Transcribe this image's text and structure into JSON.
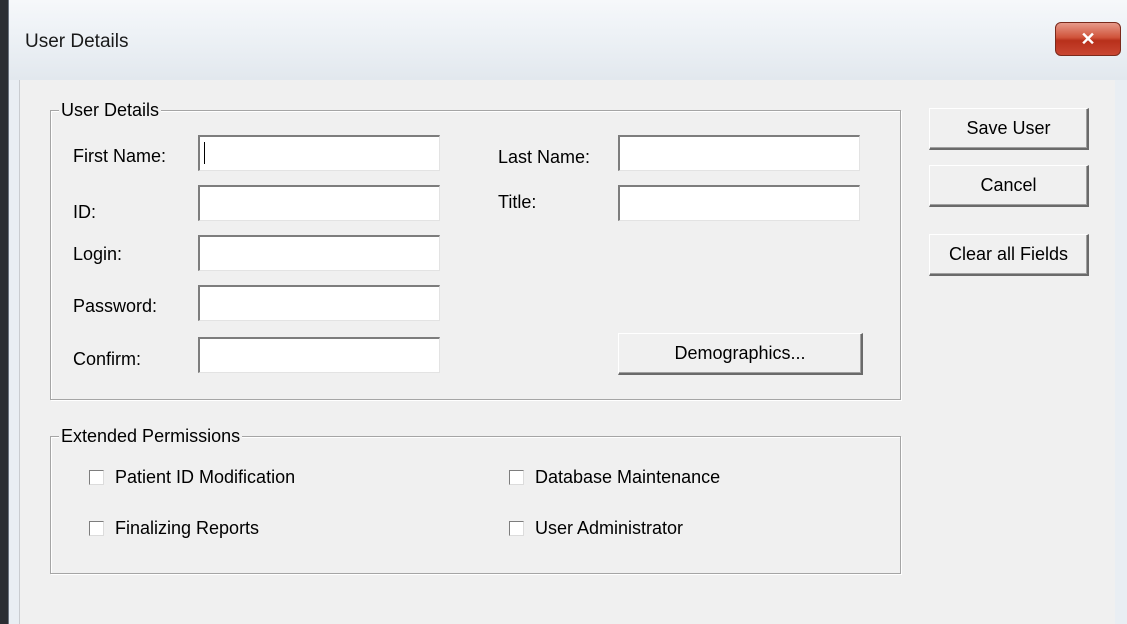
{
  "window": {
    "title": "User Details",
    "close_glyph": "✕"
  },
  "user_details": {
    "group_label": "User Details",
    "first_name": {
      "label": "First Name:",
      "value": ""
    },
    "id": {
      "label": "ID:",
      "value": ""
    },
    "login": {
      "label": "Login:",
      "value": ""
    },
    "password": {
      "label": "Password:",
      "value": ""
    },
    "confirm": {
      "label": "Confirm:",
      "value": ""
    },
    "last_name": {
      "label": "Last Name:",
      "value": ""
    },
    "title": {
      "label": "Title:",
      "value": ""
    },
    "demographics_label": "Demographics..."
  },
  "extended_permissions": {
    "group_label": "Extended Permissions",
    "items": [
      {
        "label": "Patient ID Modification",
        "checked": false
      },
      {
        "label": "Database Maintenance",
        "checked": false
      },
      {
        "label": "Finalizing Reports",
        "checked": false
      },
      {
        "label": "User Administrator",
        "checked": false
      }
    ]
  },
  "actions": {
    "save_label": "Save User",
    "cancel_label": "Cancel",
    "clear_label": "Clear all Fields"
  }
}
